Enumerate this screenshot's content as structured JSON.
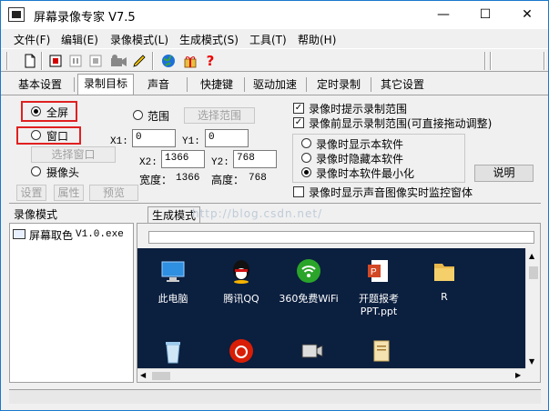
{
  "window": {
    "title": "屏幕录像专家 V7.5",
    "controls": {
      "minimize": "—",
      "maximize": "☐",
      "close": "✕"
    }
  },
  "menu": [
    "文件(F)",
    "编辑(E)",
    "录像模式(L)",
    "生成模式(S)",
    "工具(T)",
    "帮助(H)"
  ],
  "toolbar": {
    "icons": [
      "new-file-icon",
      "record-icon",
      "pause-icon",
      "stop-icon",
      "camera-icon",
      "pen-icon",
      "globe-icon",
      "gift-icon",
      "help-icon"
    ],
    "help_glyph": "?"
  },
  "tabs": [
    "基本设置",
    "录制目标",
    "声音",
    "快捷键",
    "驱动加速",
    "定时录制",
    "其它设置"
  ],
  "selected_tab": "录制目标",
  "target": {
    "fullscreen": "全屏",
    "window": "窗口",
    "select_window": "选择窗口",
    "camera": "摄像头",
    "settings": "设置",
    "properties": "属性",
    "preview": "预览",
    "range": "范围",
    "select_range": "选择范围",
    "x1_label": "X1:",
    "x1_value": "0",
    "y1_label": "Y1:",
    "y1_value": "0",
    "x2_label": "X2:",
    "x2_value": "1366",
    "y2_label": "Y2:",
    "y2_value": "768",
    "width_label": "宽度：",
    "width_value": "1366",
    "height_label": "高度：",
    "height_value": "768"
  },
  "options": {
    "show_range_while_recording": "录像时提示录制范围",
    "show_range_before_recording": "录像前显示录制范围(可直接拖动调整)",
    "show_software": "录像时显示本软件",
    "hide_software": "录像时隐藏本软件",
    "minimize_software": "录像时本软件最小化",
    "explain": "说明",
    "realtime_monitor": "录像时显示声音图像实时监控窗体"
  },
  "panels": {
    "record_mode": "录像模式",
    "gen_mode": "生成模式",
    "watermark": "http://blog.csdn.net/"
  },
  "list": [
    {
      "name": "屏幕取色",
      "file": "V1.0.exe"
    }
  ],
  "desktop_icons": [
    {
      "label": "此电脑",
      "icon": "computer-icon"
    },
    {
      "label": "腾讯QQ",
      "icon": "qq-icon"
    },
    {
      "label": "360免费WiFi",
      "icon": "wifi-icon"
    },
    {
      "label": "开题报考\nPPT.ppt",
      "line1": "开题报考",
      "line2": "PPT.ppt",
      "icon": "ppt-icon"
    },
    {
      "label": "R",
      "icon": "folder-icon"
    },
    {
      "label": "",
      "icon": "recycle-bin-icon"
    },
    {
      "label": "",
      "icon": "netease-music-icon"
    },
    {
      "label": "",
      "icon": "recorder-app-icon"
    },
    {
      "label": "",
      "icon": "document-icon"
    }
  ],
  "colors": {
    "title_bar": "#ffffff",
    "window_border": "#1979ca",
    "highlight_box": "#e02020",
    "desktop_bg": "#0b1f3f"
  }
}
